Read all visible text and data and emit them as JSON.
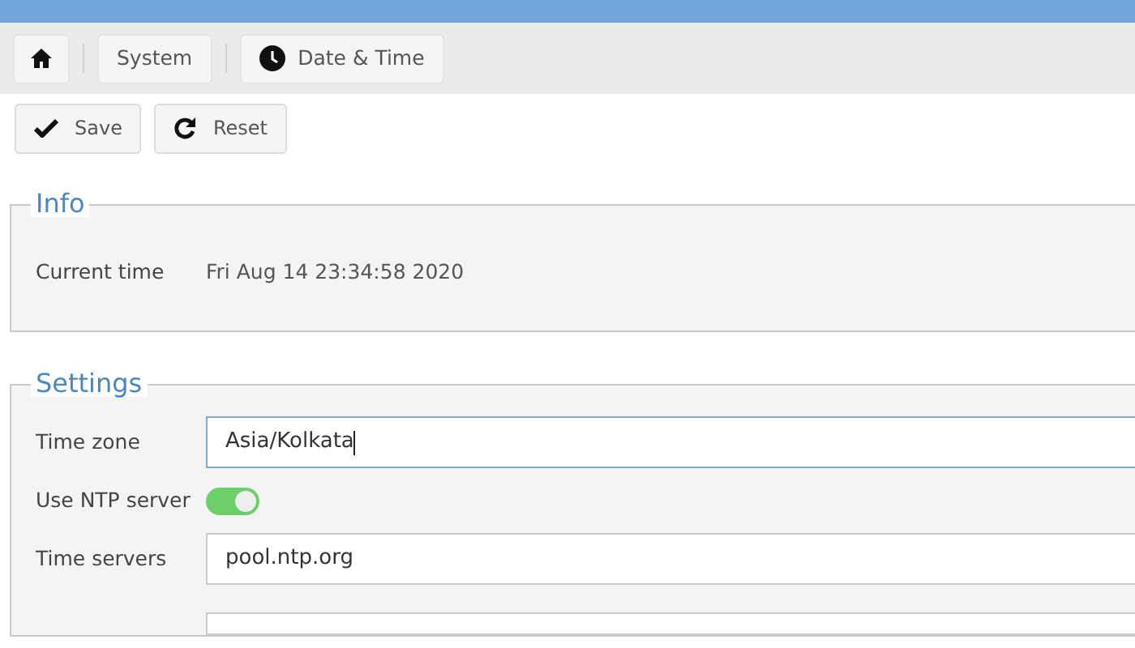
{
  "breadcrumb": [
    {
      "kind": "home"
    },
    {
      "kind": "text",
      "label": "System"
    },
    {
      "kind": "clock",
      "label": "Date & Time"
    }
  ],
  "toolbar": [
    {
      "kind": "save",
      "label": "Save"
    },
    {
      "kind": "reset",
      "label": "Reset"
    }
  ],
  "info": {
    "legend": "Info",
    "rows": [
      {
        "label": "Current time",
        "value": "Fri Aug 14 23:34:58 2020"
      }
    ]
  },
  "settings": {
    "legend": "Settings",
    "rows": [
      {
        "kind": "input",
        "label": "Time zone",
        "value": "Asia/Kolkata",
        "focused": true
      },
      {
        "kind": "toggle",
        "label": "Use NTP server",
        "on": true
      },
      {
        "kind": "input",
        "label": "Time servers",
        "value": "pool.ntp.org",
        "focused": false
      }
    ]
  }
}
